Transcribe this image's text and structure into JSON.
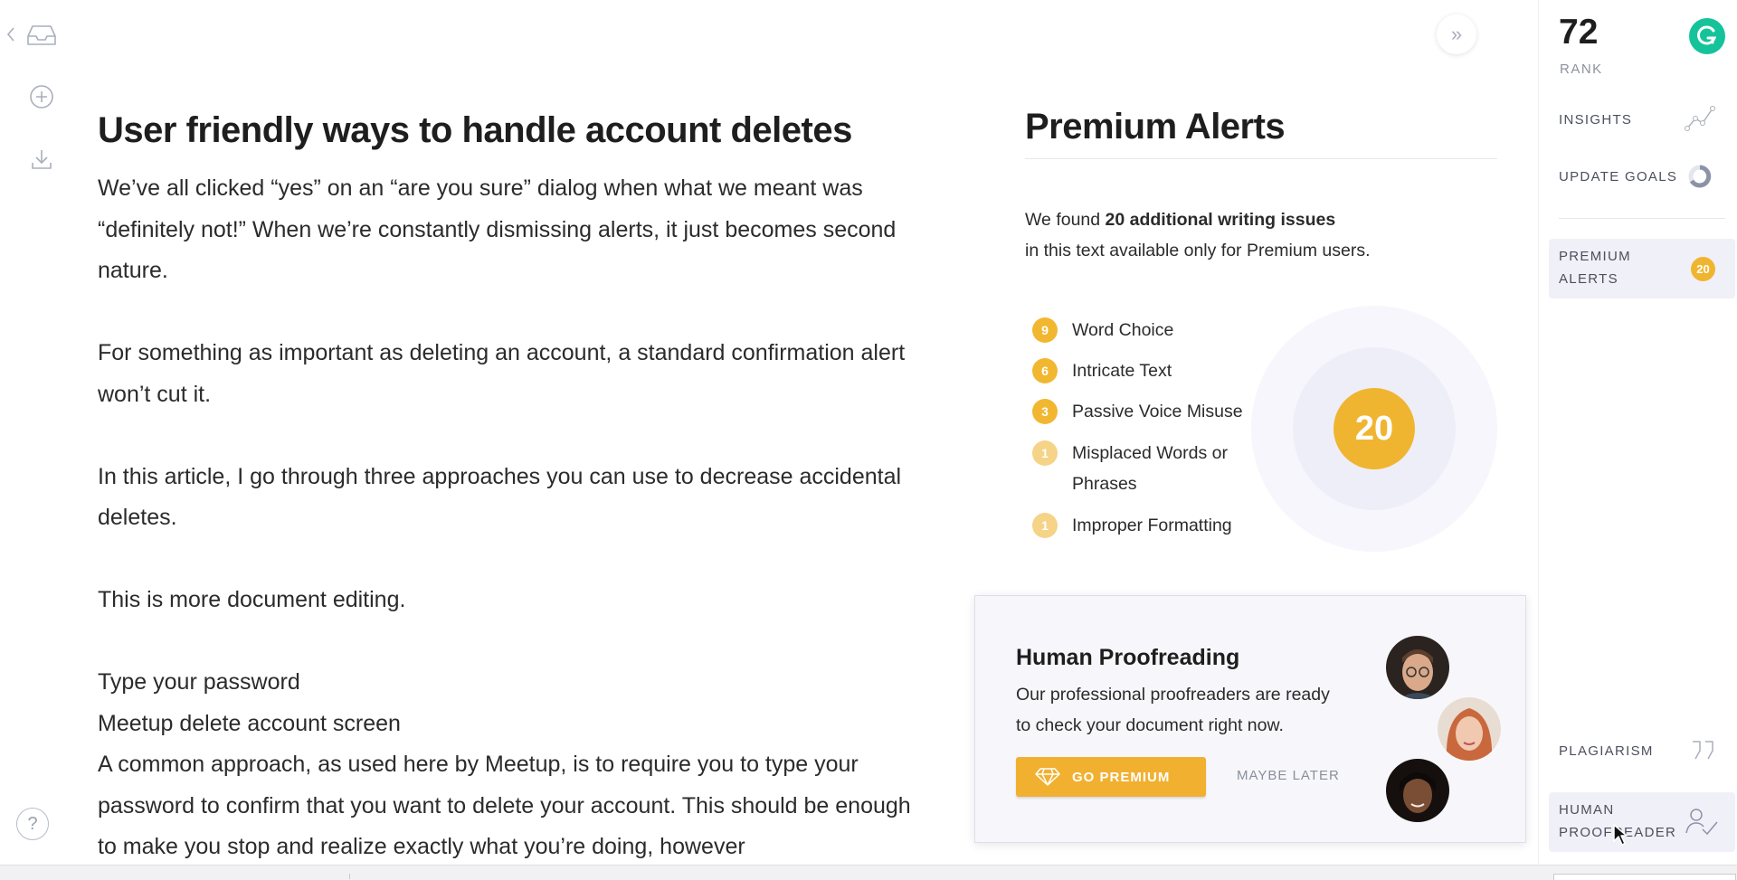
{
  "left_rail": {
    "icons": [
      "back-arrow-icon",
      "inbox-icon",
      "add-circle-icon",
      "download-icon",
      "help-icon"
    ],
    "help_label": "?"
  },
  "document": {
    "title": "User friendly ways to handle account deletes",
    "paragraphs": [
      "We’ve all clicked “yes” on an “are you sure” dialog when what we meant was “definitely not!” When we’re constantly dismissing alerts, it just becomes second nature.",
      "For something as important as deleting an account, a standard confirmation alert won’t cut it.",
      "In this article, I go through three approaches you can use to decrease accidental deletes.",
      "This is more document editing."
    ],
    "lines": [
      "Type your password",
      "Meetup delete account screen",
      "A common approach, as used here by Meetup, is to require you to type your password to confirm that you want to delete your account. This should be enough to make you stop and realize exactly what you’re doing, however"
    ]
  },
  "panel": {
    "collapse_glyph": "»",
    "title": "Premium Alerts",
    "desc_prefix": "We found ",
    "desc_bold": "20 additional writing issues",
    "desc_suffix": "in this text available only for Premium users.",
    "issues": [
      {
        "count": "9",
        "label": "Word Choice",
        "label2": ""
      },
      {
        "count": "6",
        "label": "Intricate Text",
        "label2": ""
      },
      {
        "count": "3",
        "label": "Passive Voice Misuse",
        "label2": ""
      },
      {
        "count": "1",
        "label": "Misplaced Words or",
        "label2": "Phrases"
      },
      {
        "count": "1",
        "label": "Improper Formatting",
        "label2": ""
      }
    ],
    "total": "20"
  },
  "proofreading_card": {
    "title": "Human Proofreading",
    "text_line1": "Our professional proofreaders are ready",
    "text_line2": "to check your document right now.",
    "primary_button": "GO PREMIUM",
    "secondary_button": "MAYBE LATER"
  },
  "sidebar": {
    "score": "72",
    "score_label": "RANK",
    "items": [
      {
        "line1": "INSIGHTS",
        "line2": "",
        "icon": "trend-chart-icon"
      },
      {
        "line1": "UPDATE GOALS",
        "line2": "",
        "icon": "goal-ring-icon"
      },
      {
        "line1": "PREMIUM",
        "line2": "ALERTS",
        "badge": "20"
      },
      {
        "line1": "PLAGIARISM",
        "line2": "",
        "icon": "quote-icon"
      },
      {
        "line1": "HUMAN",
        "line2": "PROOFREADER",
        "icon": "person-check-icon"
      }
    ]
  },
  "colors": {
    "accent_yellow": "#f0b530",
    "grammarly_green": "#15c39a",
    "active_bg": "#f0f0f8"
  }
}
